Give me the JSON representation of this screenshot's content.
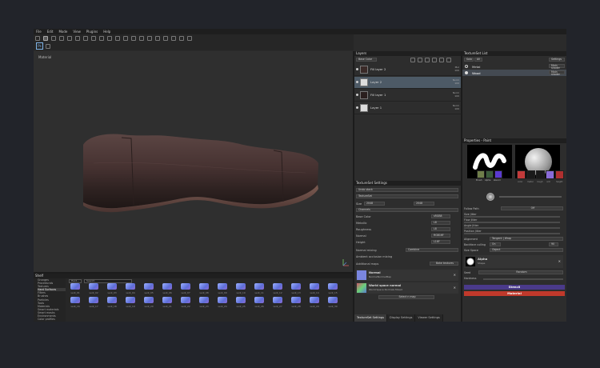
{
  "menu": [
    "File",
    "Edit",
    "Mode",
    "View",
    "Plugins",
    "Help"
  ],
  "viewport": {
    "label": "Material"
  },
  "shelf": {
    "title": "Shelf",
    "categories": [
      "Grunges",
      "Procedurals",
      "Textures",
      "Hard Surfaces",
      "Filters",
      "Brushes",
      "Particles",
      "Tools",
      "Materials",
      "Smart materials",
      "Smart masks",
      "Environments",
      "Color profiles"
    ],
    "active_category": "Hard Surfaces",
    "search_filter": "Hard...",
    "search_placeholder": "Search",
    "items": [
      "vent_01",
      "vent_02",
      "vent_03",
      "vent_04",
      "vent_05",
      "vent_06",
      "vent_07",
      "vent_08",
      "vent_09",
      "vent_10",
      "vent_11",
      "vent_12",
      "vent_13",
      "vent_14",
      "vent_15",
      "vent_16",
      "vent_17",
      "vent_18",
      "vent_19",
      "vent_20",
      "vent_21",
      "vent_22",
      "vent_23",
      "vent_24",
      "vent_25",
      "vent_26",
      "vent_27",
      "vent_28",
      "vent_29",
      "vent_30"
    ]
  },
  "layers": {
    "title": "Layers",
    "channel": "Base Color",
    "items": [
      {
        "name": "Fill layer 2",
        "blend": "Mul",
        "opacity": "100",
        "selected": false
      },
      {
        "name": "Layer 2",
        "blend": "Norm",
        "opacity": "100",
        "selected": true
      },
      {
        "name": "Fill layer 1",
        "blend": "Norm",
        "opacity": "100",
        "selected": false
      },
      {
        "name": "Layer 1",
        "blend": "Norm",
        "opacity": "100",
        "selected": false
      }
    ]
  },
  "textureset_settings": {
    "title": "TextureSet Settings",
    "undo": "Undo stack",
    "textureset_label": "TextureSet",
    "size_label": "Size",
    "size_value": "2048",
    "size_value2": "2048",
    "channels_label": "Channels",
    "channels": [
      {
        "name": "Base Color",
        "format": "sRGB8"
      },
      {
        "name": "Metallic",
        "format": "L8"
      },
      {
        "name": "Roughness",
        "format": "L8"
      },
      {
        "name": "Normal",
        "format": "RGB16F"
      },
      {
        "name": "Height",
        "format": "L16F"
      }
    ],
    "normal_mixing_label": "Normal mixing",
    "normal_mixing_value": "Combine",
    "ao_mixing_label": "Ambient occlusion mixing",
    "additional_maps_label": "Additional maps",
    "bake_button": "Bake textures",
    "maps": [
      {
        "title": "Normal",
        "sub": "NormalNormalMap"
      },
      {
        "title": "World space normal",
        "sub": "World Space Normals Mixed"
      }
    ],
    "select_map": "Select n map",
    "tabs": [
      "TextureSet Settings",
      "Display Settings",
      "Viewer Settings"
    ]
  },
  "textureset_list": {
    "title": "TextureSet List",
    "solo": "Solo",
    "all": "All",
    "settings": "Settings",
    "items": [
      {
        "name": "Metal",
        "shader": "Main shader"
      },
      {
        "name": "Wood",
        "shader": "Main shader"
      }
    ]
  },
  "properties": {
    "title": "Properties - Paint",
    "brush_labels": [
      "Brush",
      "Alpha",
      "stencil"
    ],
    "channel_swatches": [
      {
        "label": "color",
        "color": "#c23a3a"
      },
      {
        "label": "metal",
        "color": "#1a1a1a"
      },
      {
        "label": "rough",
        "color": "#1a1a1a"
      },
      {
        "label": "nrm",
        "color": "#8a6bd8"
      },
      {
        "label": "height",
        "color": "#b03030"
      }
    ],
    "follow_path": "Follow Path",
    "follow_path_value": "Off",
    "jitters": [
      "Size Jitter",
      "Flow Jitter",
      "Angle Jitter",
      "Position Jitter"
    ],
    "alignment_label": "Alignment",
    "alignment_value": "Tangent | Wrap",
    "backface_label": "Backface culling",
    "backface_value": "On",
    "backface_number": "90",
    "size_space_label": "Size Space",
    "size_space_value": "Object",
    "alpha_title": "Alpha",
    "alpha_sub": "Shape",
    "seed_label": "Seed",
    "seed_value": "Random",
    "hardness_label": "Hardness",
    "stencil_label": "Stencil",
    "stencil_color": "#4a3a8a",
    "material_label": "Material",
    "material_color": "#c0392b",
    "material_tabs": [
      "color",
      "metal",
      "rough",
      "nrm",
      "height"
    ]
  }
}
